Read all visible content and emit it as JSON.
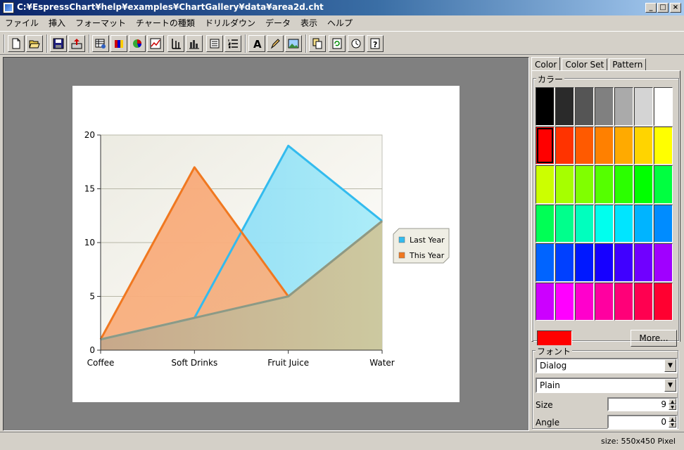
{
  "window": {
    "title": "C:¥EspressChart¥help¥examples¥ChartGallery¥data¥area2d.cht"
  },
  "menu": [
    "ファイル",
    "挿入",
    "フォーマット",
    "チャートの種類",
    "ドリルダウン",
    "データ",
    "表示",
    "ヘルプ"
  ],
  "toolbar": [
    "new-file-icon",
    "open-folder-icon",
    "save-icon",
    "export-icon",
    "data-source-icon",
    "color-bars-icon",
    "pie-chart-icon",
    "line-chart-icon",
    "axis-icon",
    "histogram-icon",
    "list-icon",
    "numbered-list-icon",
    "text-icon",
    "pen-icon",
    "image-icon",
    "copy-icon",
    "refresh-icon",
    "clock-icon",
    "help-icon"
  ],
  "tabs": [
    "Color",
    "Color Set",
    "Pattern"
  ],
  "color_group": {
    "label": "カラー",
    "more_label": "More...",
    "current": "#ff0000"
  },
  "palette": [
    [
      "#000000",
      "#2a2a2a",
      "#555555",
      "#808080",
      "#aaaaaa",
      "#d4d4d4",
      "#ffffff"
    ],
    [
      "#ff0000",
      "#ff3300",
      "#ff5a00",
      "#ff8000",
      "#ffaa00",
      "#ffd400",
      "#ffff00"
    ],
    [
      "#ccff00",
      "#a6ff00",
      "#80ff00",
      "#55ff00",
      "#2bff00",
      "#00ff00",
      "#00ff40"
    ],
    [
      "#00ff55",
      "#00ff8c",
      "#00ffbe",
      "#00ffee",
      "#00e5ff",
      "#00b4ff",
      "#008cff"
    ],
    [
      "#0064ff",
      "#0040ff",
      "#0018ff",
      "#1600ff",
      "#4000ff",
      "#7000ff",
      "#a000ff"
    ],
    [
      "#cc00ff",
      "#ff00ff",
      "#ff00cc",
      "#ff00a0",
      "#ff0078",
      "#ff0050",
      "#ff0030"
    ]
  ],
  "font_group": {
    "label": "フォント",
    "family": "Dialog",
    "style": "Plain",
    "size_label": "Size",
    "size": "9",
    "angle_label": "Angle",
    "angle": "0"
  },
  "status": {
    "text": "size: 550x450 Pixel"
  },
  "chart_data": {
    "type": "area",
    "categories": [
      "Coffee",
      "Soft Drinks",
      "Fruit Juice",
      "Water"
    ],
    "series": [
      {
        "name": "Last Year",
        "values": [
          1,
          3,
          19,
          12
        ],
        "color": "#33bbee"
      },
      {
        "name": "This Year",
        "values": [
          1,
          17,
          5,
          12
        ],
        "color": "#f07820"
      }
    ],
    "yticks": [
      0,
      5,
      10,
      15,
      20
    ],
    "ylim": [
      0,
      20
    ],
    "grid": true,
    "legend": "right"
  }
}
